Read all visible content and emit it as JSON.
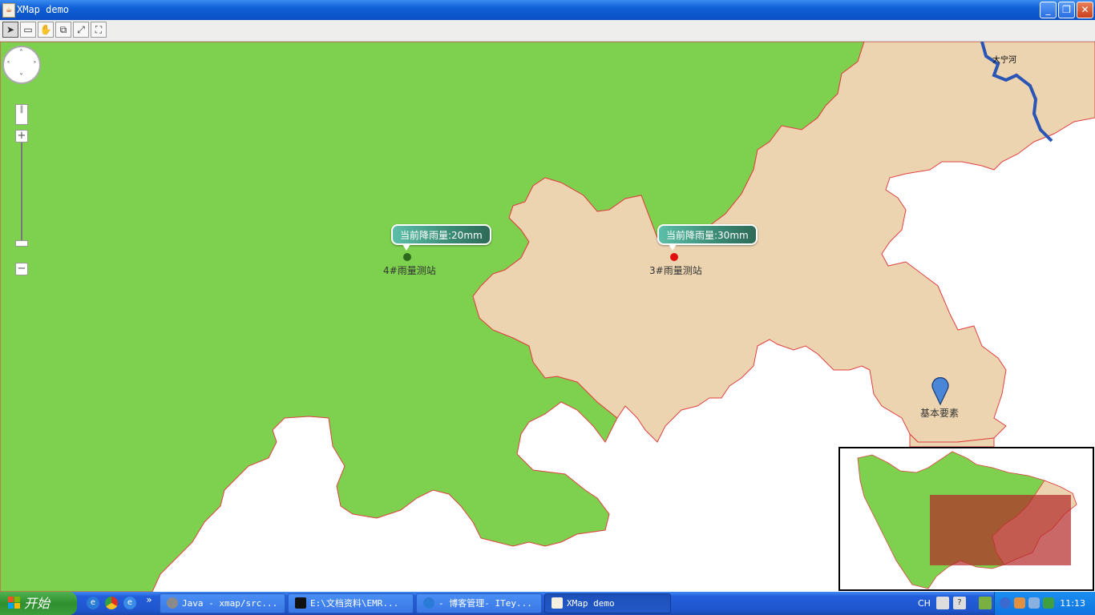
{
  "window": {
    "title": "XMap demo",
    "minimize_glyph": "_",
    "restore_glyph": "❐",
    "close_glyph": "✕"
  },
  "toolbar": {
    "tools": [
      {
        "name": "select-tool",
        "glyph": "➤"
      },
      {
        "name": "rectangle-zoom-tool",
        "glyph": "▭"
      },
      {
        "name": "pan-hand-tool",
        "glyph": "✋"
      },
      {
        "name": "zoom-box-tool",
        "glyph": "⧉"
      },
      {
        "name": "full-extent-tool",
        "glyph": "⤢"
      },
      {
        "name": "fit-view-tool",
        "glyph": "⛶"
      }
    ]
  },
  "map": {
    "colors": {
      "land_green": "#7ed04f",
      "land_tan": "#ecd4b0",
      "border": "#e04040",
      "river": "#2a55b5",
      "water": "#ffffff"
    },
    "nav": {
      "up": "˄",
      "down": "˅",
      "left": "˂",
      "right": "˃",
      "zoom_in": "+",
      "zoom_out": "−"
    },
    "stations": [
      {
        "bubble": "当前降雨量:20mm",
        "label": "4#雨量测站",
        "color": "#2d6a1e"
      },
      {
        "bubble": "当前降雨量:30mm",
        "label": "3#雨量测站",
        "color": "#e01010"
      }
    ],
    "river_label": "大宁河",
    "marker_label": "基本要素",
    "marker_color": "#4a86d8"
  },
  "taskbar": {
    "start_label": "开始",
    "chevron": "»",
    "tasks": [
      {
        "label": "Java - xmap/src..."
      },
      {
        "label": "E:\\文档资料\\EMR..."
      },
      {
        "label": "- 博客管理- ITey..."
      },
      {
        "label": "XMap demo"
      }
    ],
    "lang": "CH",
    "clock": "11:13"
  }
}
